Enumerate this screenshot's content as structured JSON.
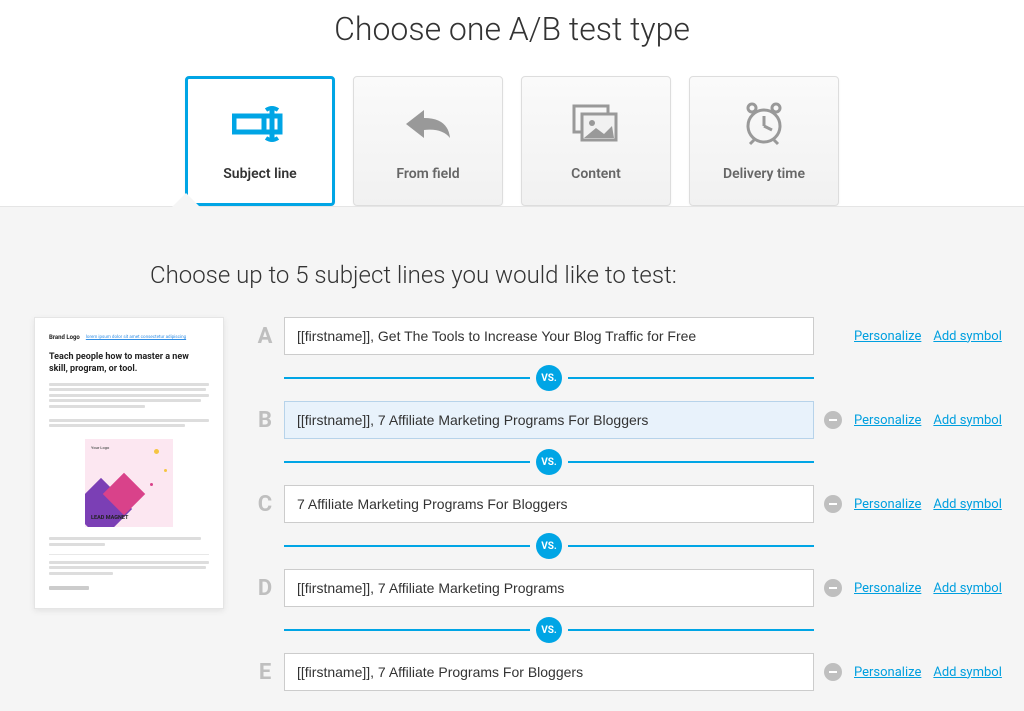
{
  "page": {
    "title": "Choose one A/B test type",
    "subtitle": "Choose up to 5 subject lines you would like to test:"
  },
  "test_types": [
    {
      "id": "subject-line",
      "label": "Subject line",
      "active": true
    },
    {
      "id": "from-field",
      "label": "From field",
      "active": false
    },
    {
      "id": "content",
      "label": "Content",
      "active": false
    },
    {
      "id": "delivery-time",
      "label": "Delivery time",
      "active": false
    }
  ],
  "subject_lines": [
    {
      "letter": "A",
      "value": "[[firstname]], Get The Tools to Increase Your Blog Traffic for Free",
      "removable": false,
      "highlight": false
    },
    {
      "letter": "B",
      "value": "[[firstname]], 7 Affiliate Marketing Programs For Bloggers",
      "removable": true,
      "highlight": true
    },
    {
      "letter": "C",
      "value": "7 Affiliate Marketing Programs For Bloggers",
      "removable": true,
      "highlight": false
    },
    {
      "letter": "D",
      "value": "[[firstname]], 7 Affiliate Marketing Programs",
      "removable": true,
      "highlight": false
    },
    {
      "letter": "E",
      "value": "[[firstname]], 7 Affiliate Programs For Bloggers",
      "removable": true,
      "highlight": false
    }
  ],
  "actions": {
    "personalize": "Personalize",
    "add_symbol": "Add symbol"
  },
  "vs_label": "VS.",
  "preview": {
    "brand": "Brand Logo",
    "url": "lorem ipsum dolor sit amet consectetur adipiscing",
    "headline": "Teach people how to master a new skill, program, or tool.",
    "lead": "LEAD MAGNET",
    "yourlogo": "Your Logo"
  }
}
